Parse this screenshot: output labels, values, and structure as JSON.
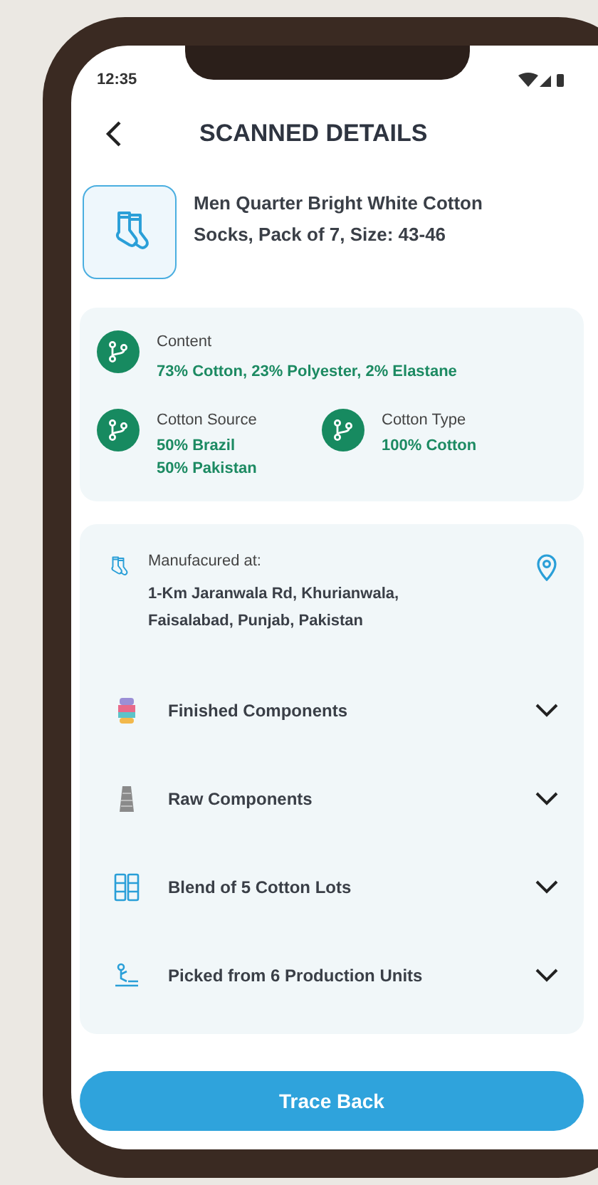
{
  "status_bar": {
    "time": "12:35"
  },
  "header": {
    "title": "SCANNED DETAILS"
  },
  "product": {
    "name": "Men Quarter Bright White Cotton Socks, Pack of 7, Size: 43-46"
  },
  "composition": {
    "content": {
      "label": "Content",
      "value": "73% Cotton, 23% Polyester, 2% Elastane"
    },
    "facts": [
      {
        "label": "Cotton Source",
        "values": [
          "50% Brazil",
          "50% Pakistan"
        ]
      },
      {
        "label": "Cotton Type",
        "values": [
          "100% Cotton"
        ]
      }
    ]
  },
  "manufacturer": {
    "label": "Manufacured at:",
    "address": "1-Km Jaranwala Rd, Khurianwala, Faisalabad, Punjab, Pakistan"
  },
  "sections": [
    {
      "kind": "finished",
      "label": "Finished Components",
      "expanded": false
    },
    {
      "kind": "raw",
      "label": "Raw Components",
      "expanded": false
    },
    {
      "kind": "blend",
      "label": "Blend of 5 Cotton Lots",
      "expanded": false
    },
    {
      "kind": "picked",
      "label": "Picked from 6 Production Units",
      "expanded": false
    }
  ],
  "action": {
    "label": "Trace Back"
  }
}
